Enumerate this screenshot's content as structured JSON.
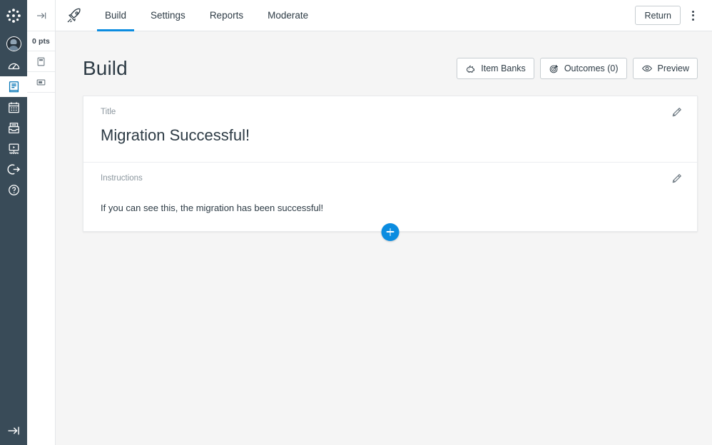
{
  "global_nav": {
    "logo": "canvas-logo",
    "items": [
      {
        "name": "account",
        "icon": "avatar-icon"
      },
      {
        "name": "dashboard",
        "icon": "dashboard-speedometer-icon"
      },
      {
        "name": "courses",
        "icon": "courses-book-icon",
        "active": true
      },
      {
        "name": "calendar",
        "icon": "calendar-icon"
      },
      {
        "name": "inbox",
        "icon": "inbox-tray-icon"
      },
      {
        "name": "history",
        "icon": "history-screen-icon"
      },
      {
        "name": "commons",
        "icon": "logout-arrow-icon"
      },
      {
        "name": "help",
        "icon": "help-question-icon"
      }
    ],
    "collapse_icon": "arrow-to-bar-icon"
  },
  "quiz_nav": {
    "collapse_icon": "arrow-to-bar-icon",
    "points_label": "0 pts",
    "items": [
      {
        "name": "page-item",
        "icon": "document-page-icon"
      },
      {
        "name": "banner-item",
        "icon": "banner-card-icon"
      }
    ]
  },
  "topbar": {
    "brand_icon": "rocket-icon",
    "tabs": [
      {
        "label": "Build",
        "active": true
      },
      {
        "label": "Settings",
        "active": false
      },
      {
        "label": "Reports",
        "active": false
      },
      {
        "label": "Moderate",
        "active": false
      }
    ],
    "return_label": "Return",
    "menu_icon": "kebab-menu-icon",
    "active_tab_color": "#0B8CE0"
  },
  "page": {
    "title": "Build",
    "actions": [
      {
        "label": "Item Banks",
        "icon": "item-bank-icon"
      },
      {
        "label": "Outcomes (0)",
        "icon": "outcomes-target-icon"
      },
      {
        "label": "Preview",
        "icon": "eye-preview-icon"
      }
    ]
  },
  "quiz_card": {
    "title_label": "Title",
    "title_value": "Migration Successful!",
    "instructions_label": "Instructions",
    "instructions_value": "If you can see this, the migration has been successful!",
    "edit_icon": "pencil-edit-icon",
    "add_icon": "plus-icon"
  },
  "colors": {
    "nav_background": "#394B58",
    "accent_blue": "#0B8CE0",
    "link_blue": "#0374B5",
    "page_background": "#f5f5f5",
    "text_primary": "#2d3b45",
    "text_muted": "#8b969e"
  }
}
